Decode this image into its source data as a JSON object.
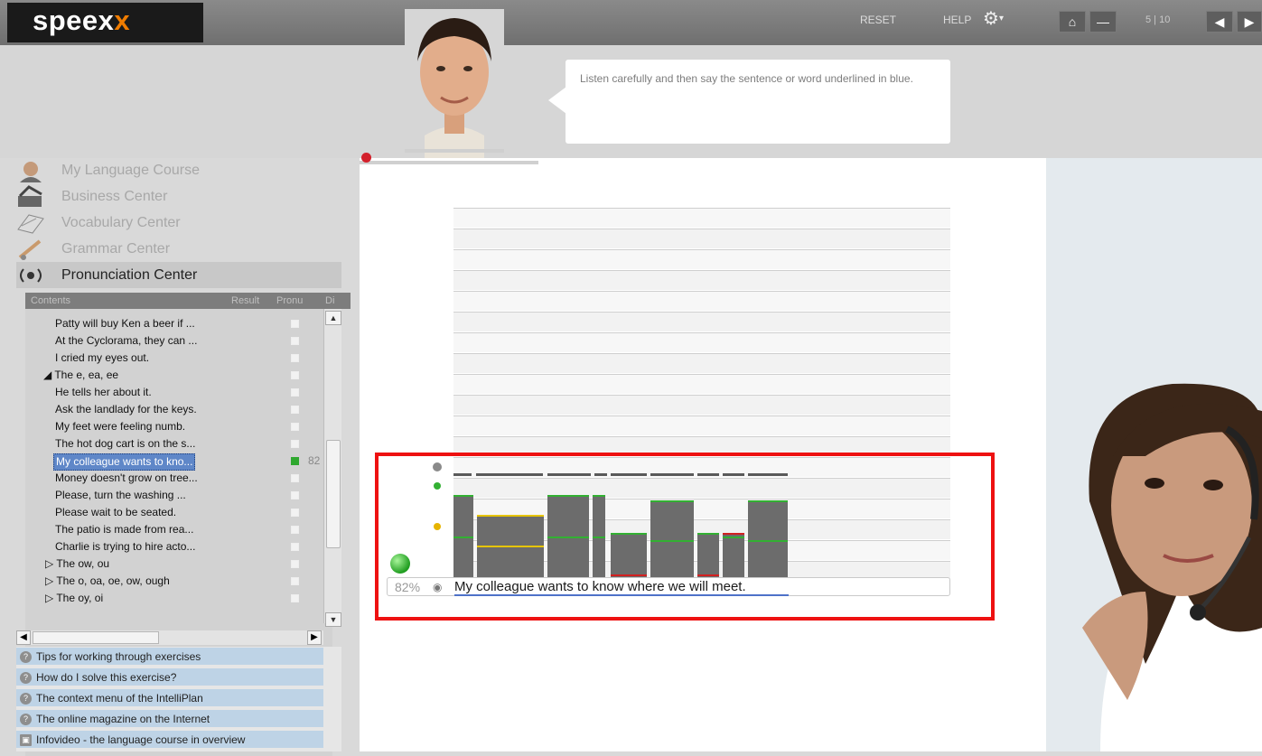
{
  "topbar": {
    "logo_text": "speex",
    "logo_accent": "x",
    "reset_label": "RESET",
    "help_label": "HELP",
    "page_counter": "5 | 10"
  },
  "instruction": {
    "text": "Listen carefully and then say the sentence or word underlined in blue."
  },
  "centers": [
    {
      "label": "My Language Course",
      "icon": "language-course-icon"
    },
    {
      "label": "Business Center",
      "icon": "business-center-icon"
    },
    {
      "label": "Vocabulary Center",
      "icon": "vocabulary-center-icon"
    },
    {
      "label": "Grammar Center",
      "icon": "grammar-center-icon"
    },
    {
      "label": "Pronunciation Center",
      "icon": "pronunciation-center-icon",
      "active": true
    }
  ],
  "contents_table": {
    "headers": [
      "Contents",
      "Result",
      "Pronu",
      "Di"
    ],
    "rows": [
      {
        "text": "Patty will buy Ken a beer if ...",
        "level": 2,
        "checked": false
      },
      {
        "text": "At the Cyclorama, they can ...",
        "level": 2,
        "checked": false
      },
      {
        "text": "I cried my eyes out.",
        "level": 2,
        "checked": false
      },
      {
        "text": "◢ The e, ea, ee",
        "level": 1,
        "checked": false
      },
      {
        "text": "He tells her about it.",
        "level": 2,
        "checked": false
      },
      {
        "text": "Ask the landlady for the keys.",
        "level": 2,
        "checked": false
      },
      {
        "text": "My feet were feeling numb.",
        "level": 2,
        "checked": false
      },
      {
        "text": "The hot dog cart is on the s...",
        "level": 2,
        "checked": false
      },
      {
        "text": "My colleague wants to kno...",
        "level": 2,
        "checked": true,
        "score": "82",
        "selected": true
      },
      {
        "text": "Money doesn't grow on tree...",
        "level": 2,
        "checked": false
      },
      {
        "text": "Please, turn the washing ...",
        "level": 2,
        "checked": false
      },
      {
        "text": "Please wait to be seated.",
        "level": 2,
        "checked": false
      },
      {
        "text": "The patio is made from rea...",
        "level": 2,
        "checked": false
      },
      {
        "text": "Charlie is trying to hire acto...",
        "level": 2,
        "checked": false
      },
      {
        "text": "▷ The ow, ou",
        "level": 1,
        "checked": false
      },
      {
        "text": "▷ The o, oa, oe, ow, ough",
        "level": 1,
        "checked": false
      },
      {
        "text": "▷ The oy, oi",
        "level": 1,
        "checked": false
      }
    ]
  },
  "help_items": [
    {
      "text": "Tips for working through exercises",
      "icon": "help-icon"
    },
    {
      "text": "How do I solve this exercise?",
      "icon": "help-icon"
    },
    {
      "text": "The context menu of the IntelliPlan",
      "icon": "help-icon"
    },
    {
      "text": "The online magazine on the Internet",
      "icon": "help-icon"
    },
    {
      "text": "Infovideo - the language course in overview",
      "icon": "video-icon"
    }
  ],
  "exercise": {
    "score_percent": "82%",
    "sentence": "My colleague wants to know where we will meet."
  },
  "colors": {
    "accent": "#f07c00",
    "highlight_border": "#ee1111",
    "good": "#32b032",
    "warn": "#e6c400",
    "bad": "#d22020",
    "underline": "#4e72c9"
  }
}
